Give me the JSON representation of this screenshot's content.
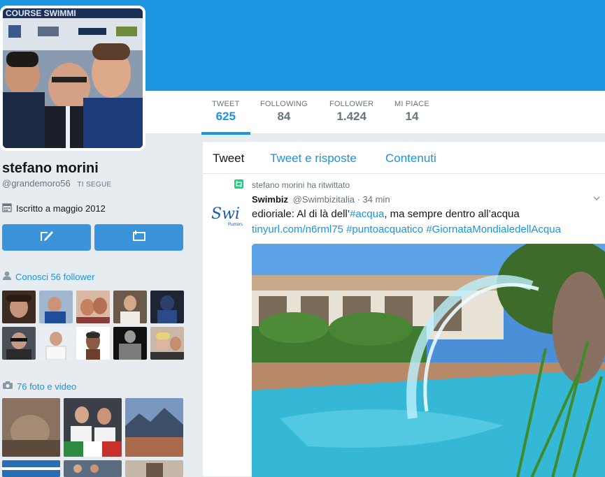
{
  "profile": {
    "name": "stefano morini",
    "handle": "@grandemoro56",
    "follows_you": "TI SEGUE",
    "joined": "Iscritto a maggio 2012",
    "banner_text": "COURSE SWIMMI"
  },
  "nav": {
    "stats": [
      {
        "label": "TWEET",
        "value": "625"
      },
      {
        "label": "FOLLOWING",
        "value": "84"
      },
      {
        "label": "FOLLOWER",
        "value": "1.424"
      },
      {
        "label": "MI PIACE",
        "value": "14"
      }
    ]
  },
  "sidebar": {
    "followers_link": "Conosci 56 follower",
    "media_link": "76 foto e video"
  },
  "timeline": {
    "tabs": [
      "Tweet",
      "Tweet e risposte",
      "Contenuti"
    ],
    "retweet_context": "stefano morini ha ritwittato",
    "tweet": {
      "author": "Swimbiz",
      "handle": "@Swimbizitalia",
      "time": "· 34 min",
      "avatar_text": "Swi",
      "avatar_subtext": "Rumors",
      "text_1": "edioriale: Al di là dell’",
      "hashtag_1": "#acqua",
      "text_2": ", ma sempre dentro all’acqua",
      "link": "tinyurl.com/n6rml75",
      "hashtag_2": "#puntoacquatico",
      "hashtag_3": "#GiornataMondialedellAcqua"
    }
  },
  "colors": {
    "accent": "#1b95e0",
    "button": "#3b94d9",
    "retweet": "#19cf86"
  }
}
